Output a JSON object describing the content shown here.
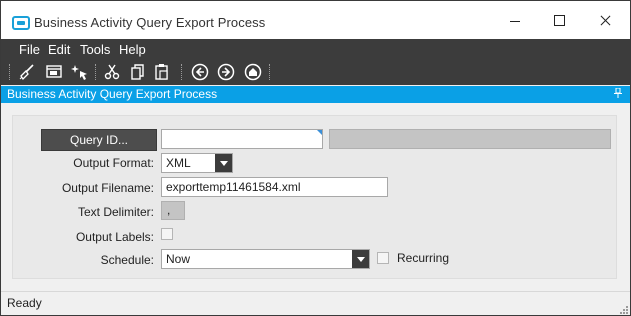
{
  "window": {
    "title": "Business Activity Query Export Process"
  },
  "menu": {
    "items": [
      "File",
      "Edit",
      "Tools",
      "Help"
    ]
  },
  "toolbar": {
    "icons": [
      "broom-icon",
      "window-icon",
      "sparkle-arrow-icon",
      "cut-icon",
      "copy-icon",
      "paste-icon",
      "back-icon",
      "forward-icon",
      "home-icon"
    ]
  },
  "panel": {
    "title": "Business Activity Query Export Process"
  },
  "form": {
    "query_button": "Query ID...",
    "query_id_value": "",
    "query_desc_value": "",
    "output_format_label": "Output Format:",
    "output_format_value": "XML",
    "output_filename_label": "Output Filename:",
    "output_filename_value": "exporttemp11461584.xml",
    "text_delimiter_label": "Text Delimiter:",
    "text_delimiter_value": ",",
    "output_labels_label": "Output Labels:",
    "output_labels_checked": false,
    "schedule_label": "Schedule:",
    "schedule_value": "Now",
    "recurring_label": "Recurring",
    "recurring_checked": false
  },
  "status": {
    "text": "Ready"
  },
  "colors": {
    "accent": "#0aa0e6",
    "chrome": "#3c3c3c",
    "icon_blue": "#1aa0d8"
  }
}
